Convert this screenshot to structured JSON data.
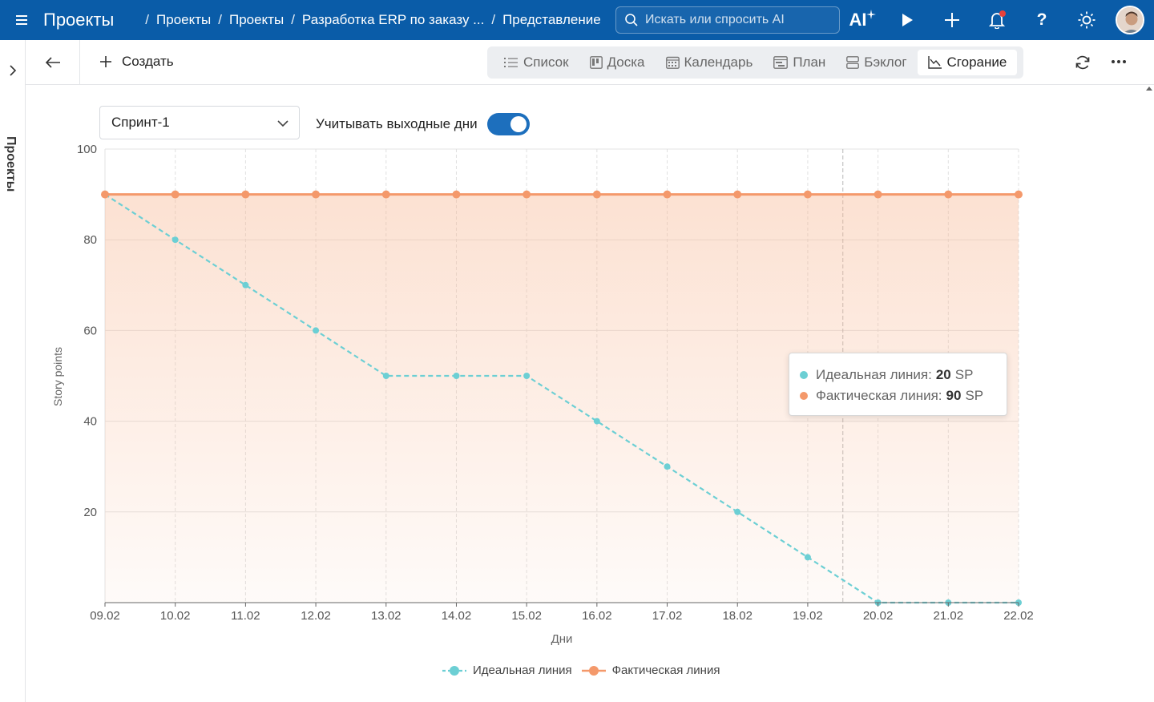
{
  "topbar": {
    "app_title": "Проекты",
    "breadcrumbs": [
      "Проекты",
      "Проекты",
      "Разработка ERP по заказу ...",
      "Представление"
    ],
    "search_placeholder": "Искать или спросить AI",
    "ai_label": "AI",
    "help_label": "?"
  },
  "rail": {
    "label": "Проекты"
  },
  "toolbar": {
    "create_label": "Создать",
    "views": [
      {
        "label": "Список",
        "icon": "list-icon"
      },
      {
        "label": "Доска",
        "icon": "board-icon"
      },
      {
        "label": "Календарь",
        "icon": "calendar-icon"
      },
      {
        "label": "План",
        "icon": "plan-icon"
      },
      {
        "label": "Бэклог",
        "icon": "backlog-icon"
      },
      {
        "label": "Сгорание",
        "icon": "burndown-icon",
        "active": true
      }
    ]
  },
  "filters": {
    "sprint_value": "Спринт-1",
    "weekends_label": "Учитывать выходные дни",
    "weekends_enabled": true
  },
  "tooltip": {
    "ideal_label": "Идеальная линия:",
    "ideal_value": "20",
    "actual_label": "Фактическая линия:",
    "actual_value": "90",
    "unit": "SP"
  },
  "colors": {
    "ideal": "#6ccfd4",
    "actual": "#f4996b",
    "brand": "#0a5ca8"
  },
  "chart_data": {
    "type": "line",
    "xlabel": "Дни",
    "ylabel": "Story points",
    "ylim": [
      0,
      100
    ],
    "yticks": [
      "20",
      "40",
      "60",
      "80",
      "100"
    ],
    "categories": [
      "09.02",
      "10.02",
      "11.02",
      "12.02",
      "13.02",
      "14.02",
      "15.02",
      "16.02",
      "17.02",
      "18.02",
      "19.02",
      "20.02",
      "21.02",
      "22.02"
    ],
    "series": [
      {
        "name": "Идеальная линия",
        "values": [
          90,
          80,
          70,
          60,
          50,
          50,
          50,
          40,
          30,
          20,
          10,
          0,
          0,
          0
        ],
        "style": "dashed"
      },
      {
        "name": "Фактическая линия",
        "values": [
          90,
          90,
          90,
          90,
          90,
          90,
          90,
          90,
          90,
          90,
          90,
          90,
          90,
          90
        ],
        "style": "solid",
        "area": true
      }
    ],
    "grid": true,
    "legend_position": "bottom"
  }
}
